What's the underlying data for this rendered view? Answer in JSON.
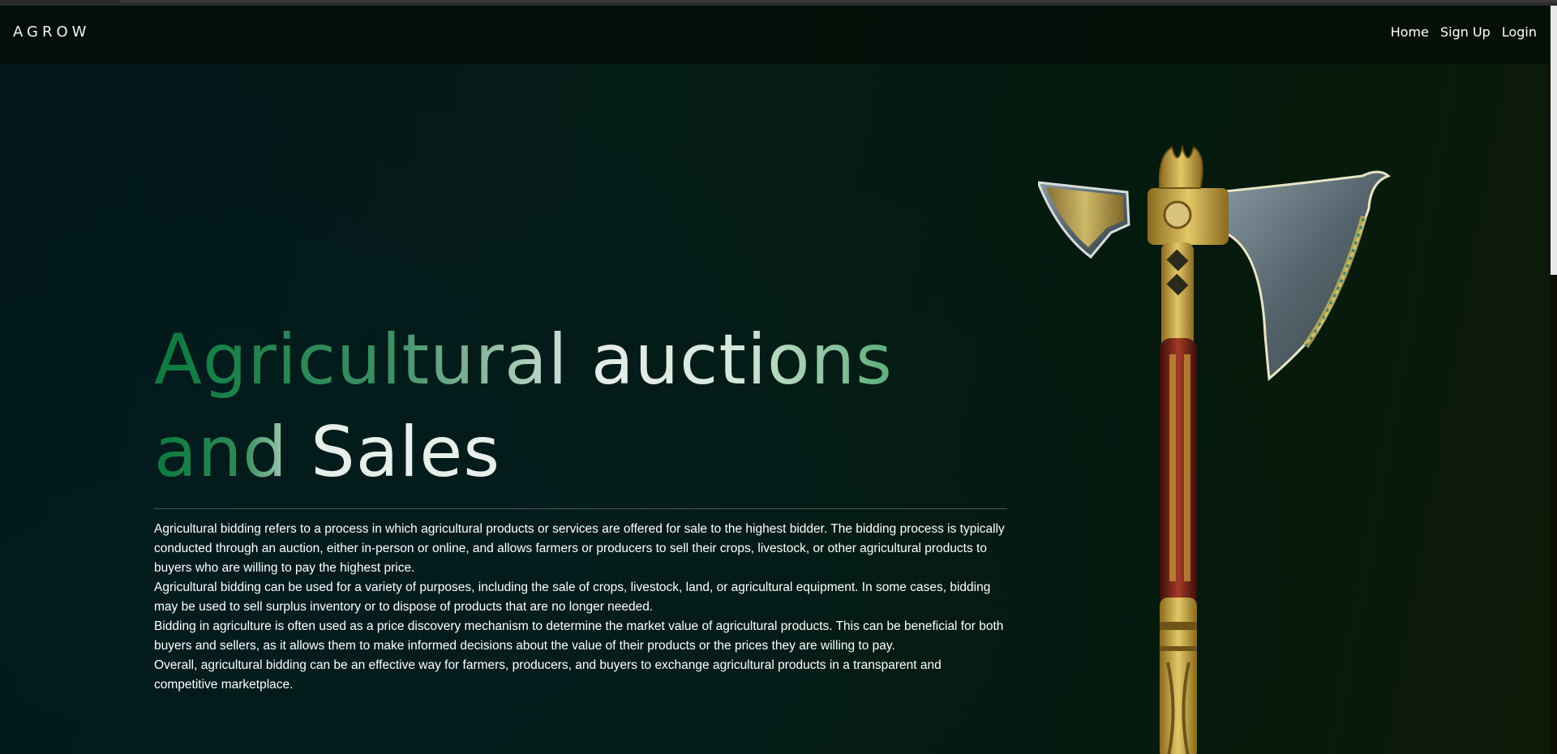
{
  "header": {
    "brand": "AGROW",
    "nav": {
      "home": "Home",
      "signup": "Sign Up",
      "login": "Login"
    }
  },
  "hero": {
    "title_line1": "Agricultural auctions",
    "title_line2": "and Sales",
    "paragraphs": [
      "Agricultural bidding refers to a process in which agricultural products or services are offered for sale to the highest bidder. The bidding process is typically conducted through an auction, either in-person or online, and allows farmers or producers to sell their crops, livestock, or other agricultural products to buyers who are willing to pay the highest price.",
      "Agricultural bidding can be used for a variety of purposes, including the sale of crops, livestock, land, or agricultural equipment. In some cases, bidding may be used to sell surplus inventory or to dispose of products that are no longer needed.",
      "Bidding in agriculture is often used as a price discovery mechanism to determine the market value of agricultural products. This can be beneficial for both buyers and sellers, as it allows them to make informed decisions about the value of their products or the prices they are willing to pay.",
      "Overall, agricultural bidding can be an effective way for farmers, producers, and buyers to exchange agricultural products in a transparent and competitive marketplace."
    ]
  },
  "colors": {
    "background": "#031a14",
    "title_green": "#0a7a3e",
    "title_light": "#e6ece8",
    "axe_blade": "#5e6e76",
    "axe_gold": "#c8a43a",
    "axe_handle": "#7a2418"
  },
  "icons": {
    "hero_image": "axe-illustration"
  }
}
